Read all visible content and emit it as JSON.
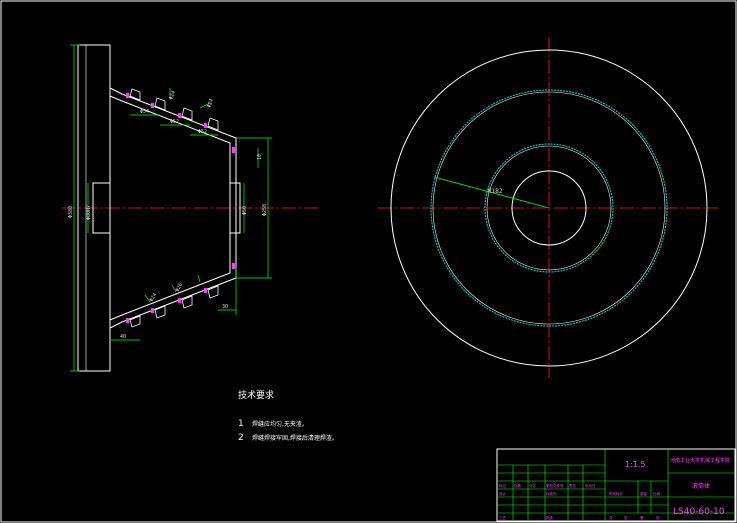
{
  "colors": {
    "background": "#000000",
    "outline": "#ffffff",
    "centerline": "#ff2020",
    "dimension": "#00ff00",
    "hidden": "#00dede",
    "weld": "#ff40ff",
    "title_block_text": "#ff40ff"
  },
  "drawing": {
    "dims_left": {
      "d_outer": "Φ380",
      "d_hub": "Φ80H7",
      "d_bore": "Φ50",
      "d_right": "Φ250",
      "d_small": "Φ26",
      "a": "Φ24",
      "b": "Φ24",
      "c": "Φ24",
      "pitch1": "Φ54",
      "pitch2": "Φ52",
      "pitch3": "Φ52",
      "bottom_width": "40",
      "right_bottom": "30",
      "right_top": "10"
    },
    "radius_label": "R182"
  },
  "notes": {
    "title": "技术要求",
    "items": [
      {
        "num": "1",
        "text": "焊缝应均匀,无夹渣。"
      },
      {
        "num": "2",
        "text": "焊缝焊接牢固,焊接后清理焊渣。"
      }
    ]
  },
  "title_block": {
    "scale": "1:1.5",
    "school": "河南工业大学机械工程学院",
    "part_name": "滚筒体",
    "drawing_no": "LS40-60-10",
    "row_labels": [
      "标记",
      "处数",
      "分区",
      "更改文件号",
      "签名",
      "年月日"
    ],
    "row_labels2": [
      "设计",
      "标准化",
      "阶段标记",
      "重量",
      "比例"
    ],
    "bottom_labels": [
      "工艺",
      "批准",
      "共",
      "张",
      "第",
      "张"
    ]
  }
}
